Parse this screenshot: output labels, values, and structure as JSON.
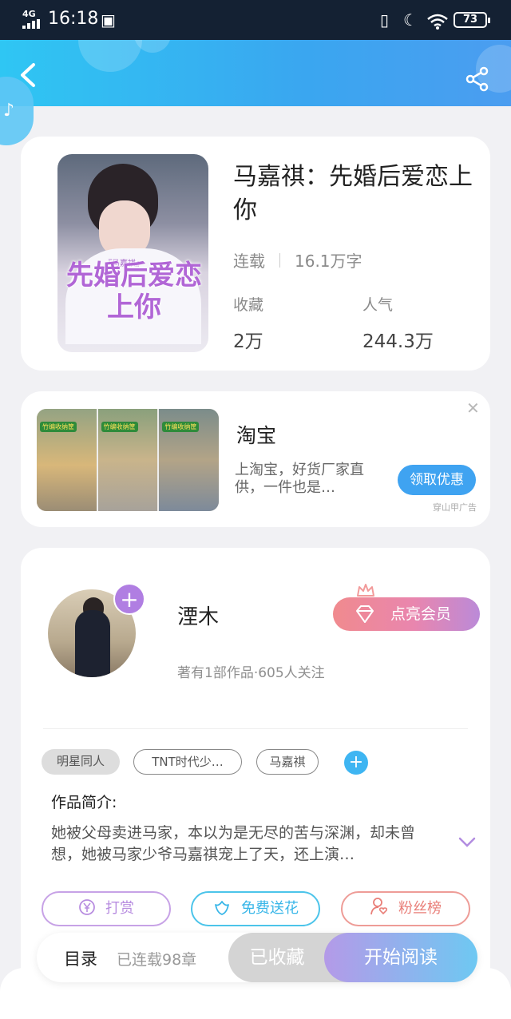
{
  "status_bar": {
    "network": "4G",
    "time": "16:18",
    "battery": "73",
    "icons": [
      "signal-icon",
      "sim-icon",
      "vibrate-icon",
      "moon-icon",
      "wifi-icon",
      "battery-icon"
    ]
  },
  "header": {
    "back_icon": "back-arrow-icon",
    "share_icon": "share-icon"
  },
  "book": {
    "title": "马嘉祺：先婚后爱恋上你",
    "cover_text": "先婚后爱恋上你",
    "cover_tag": "『马嘉祺』",
    "status": "连载",
    "word_count": "16.1万字",
    "collect_label": "收藏",
    "collect_value": "2万",
    "popularity_label": "人气",
    "popularity_value": "244.3万"
  },
  "ad": {
    "title": "淘宝",
    "description": "上淘宝，好货厂家直供，一件也是…",
    "button": "领取优惠",
    "source": "穿山甲广告",
    "image_labels": [
      "竹编收纳筐",
      "竹编收纳筐",
      "竹编收纳筐"
    ],
    "close_icon": "close-icon"
  },
  "author": {
    "name": "湮木",
    "stats": "著有1部作品·605人关注",
    "vip_button": "点亮会员",
    "follow_icon": "plus-icon"
  },
  "tags": [
    "明星同人",
    "TNT时代少…",
    "马嘉祺"
  ],
  "intro": {
    "label": "作品简介:",
    "text": "她被父母卖进马家，本以为是无尽的苦与深渊，却未曾想，她被马家少爷马嘉祺宠上了天，还上演…"
  },
  "actions": {
    "reward": "打赏",
    "flower": "免费送花",
    "fans": "粉丝榜"
  },
  "bottom": {
    "toc_label": "目录",
    "toc_count": "已连载98章",
    "collected": "已收藏",
    "read": "开始阅读"
  },
  "colors": {
    "header_gradient_start": "#2fc6f3",
    "header_gradient_end": "#4b9df0",
    "accent_blue": "#3fa3f1",
    "vip_pink": "#f08a8e",
    "vip_purple": "#bb8ad8",
    "read_gradient_start": "#b49ae8",
    "read_gradient_end": "#6ec8f2"
  }
}
